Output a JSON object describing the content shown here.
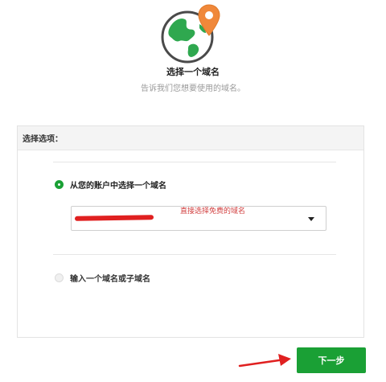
{
  "header": {
    "title": "选择一个域名",
    "subtitle": "告诉我们您想要使用的域名。",
    "icon": "globe-location-pin-icon",
    "icon_colors": {
      "globe": "#2fa84f",
      "pin": "#f0883a"
    }
  },
  "panel": {
    "heading": "选择选项：",
    "options": [
      {
        "label": "从您的账户中选择一个域名",
        "checked": true
      },
      {
        "label": "输入一个域名或子域名",
        "checked": false
      }
    ],
    "select": {
      "value": "",
      "redacted": true
    }
  },
  "annotations": {
    "note": "直接选择免费的域名",
    "note_color": "#d24040",
    "arrow_color": "#e02020"
  },
  "footer": {
    "next_label": "下一步",
    "accent": "#1aa035"
  }
}
